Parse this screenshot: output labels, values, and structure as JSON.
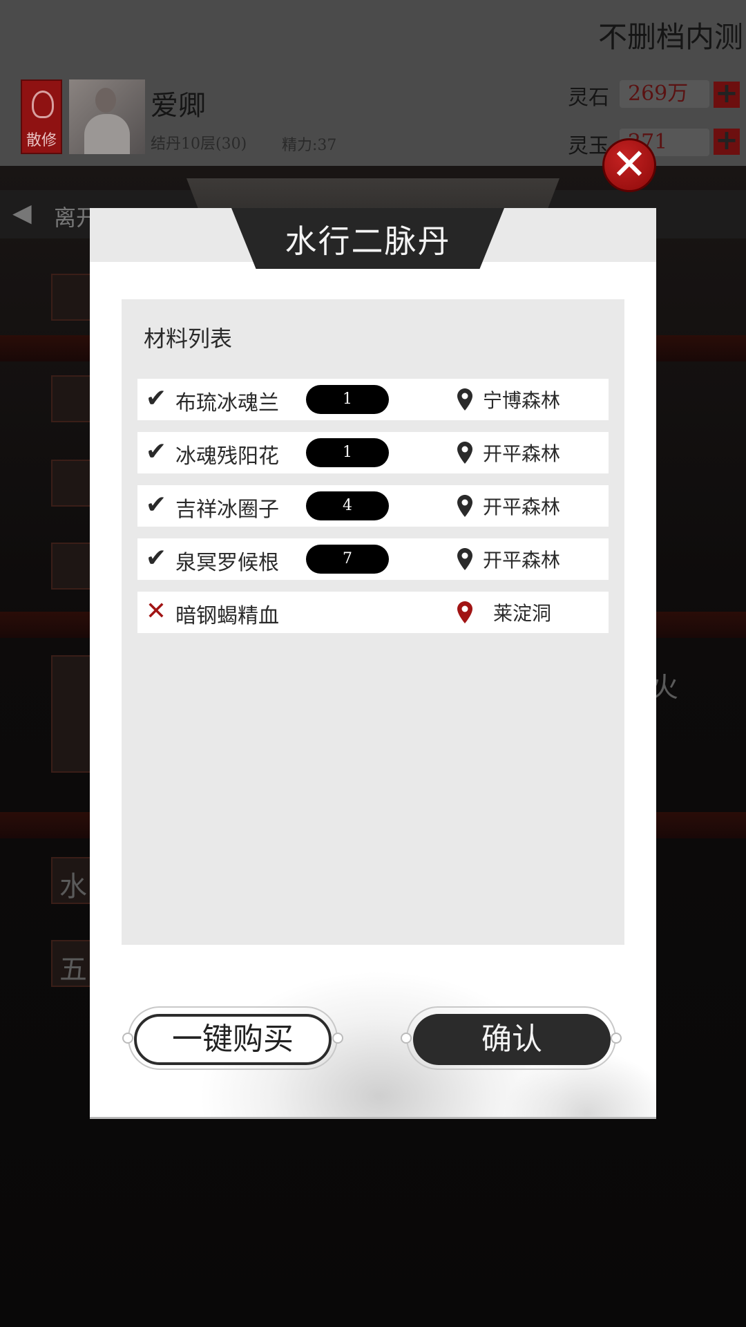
{
  "top_bar": {
    "test_label": "不删档内测",
    "sect_label": "散修",
    "player_name": "爱卿",
    "player_level": "结丹10层(30)",
    "player_energy": "精力:37",
    "spirit_stone_label": "灵石",
    "spirit_stone_value": "269万",
    "spirit_jade_label": "灵玉",
    "spirit_jade_value": "271"
  },
  "background": {
    "leave_label": "离开",
    "ghost_left_1": "水",
    "ghost_left_2": "五",
    "ghost_right": "火"
  },
  "dialog": {
    "title": "水行二脉丹",
    "materials_header": "材料列表",
    "materials": [
      {
        "status": "ok",
        "name": "布琉冰魂兰",
        "count": "1",
        "location": "宁博森林"
      },
      {
        "status": "ok",
        "name": "冰魂残阳花",
        "count": "1",
        "location": "开平森林"
      },
      {
        "status": "ok",
        "name": "吉祥冰圈子",
        "count": "4",
        "location": "开平森林"
      },
      {
        "status": "ok",
        "name": "泉冥罗候根",
        "count": "7",
        "location": "开平森林"
      },
      {
        "status": "missing",
        "name": "暗钢蝎精血",
        "count": "",
        "location": "莱淀洞"
      }
    ],
    "buy_all_label": "一键购买",
    "confirm_label": "确认"
  },
  "icons": {
    "ok": "check-icon",
    "missing": "cross-icon",
    "location": "map-pin-icon",
    "close": "close-icon"
  },
  "colors": {
    "accent_red": "#a11414",
    "dark_button": "#2b2b2b",
    "panel_gray": "#e9e9e9"
  }
}
